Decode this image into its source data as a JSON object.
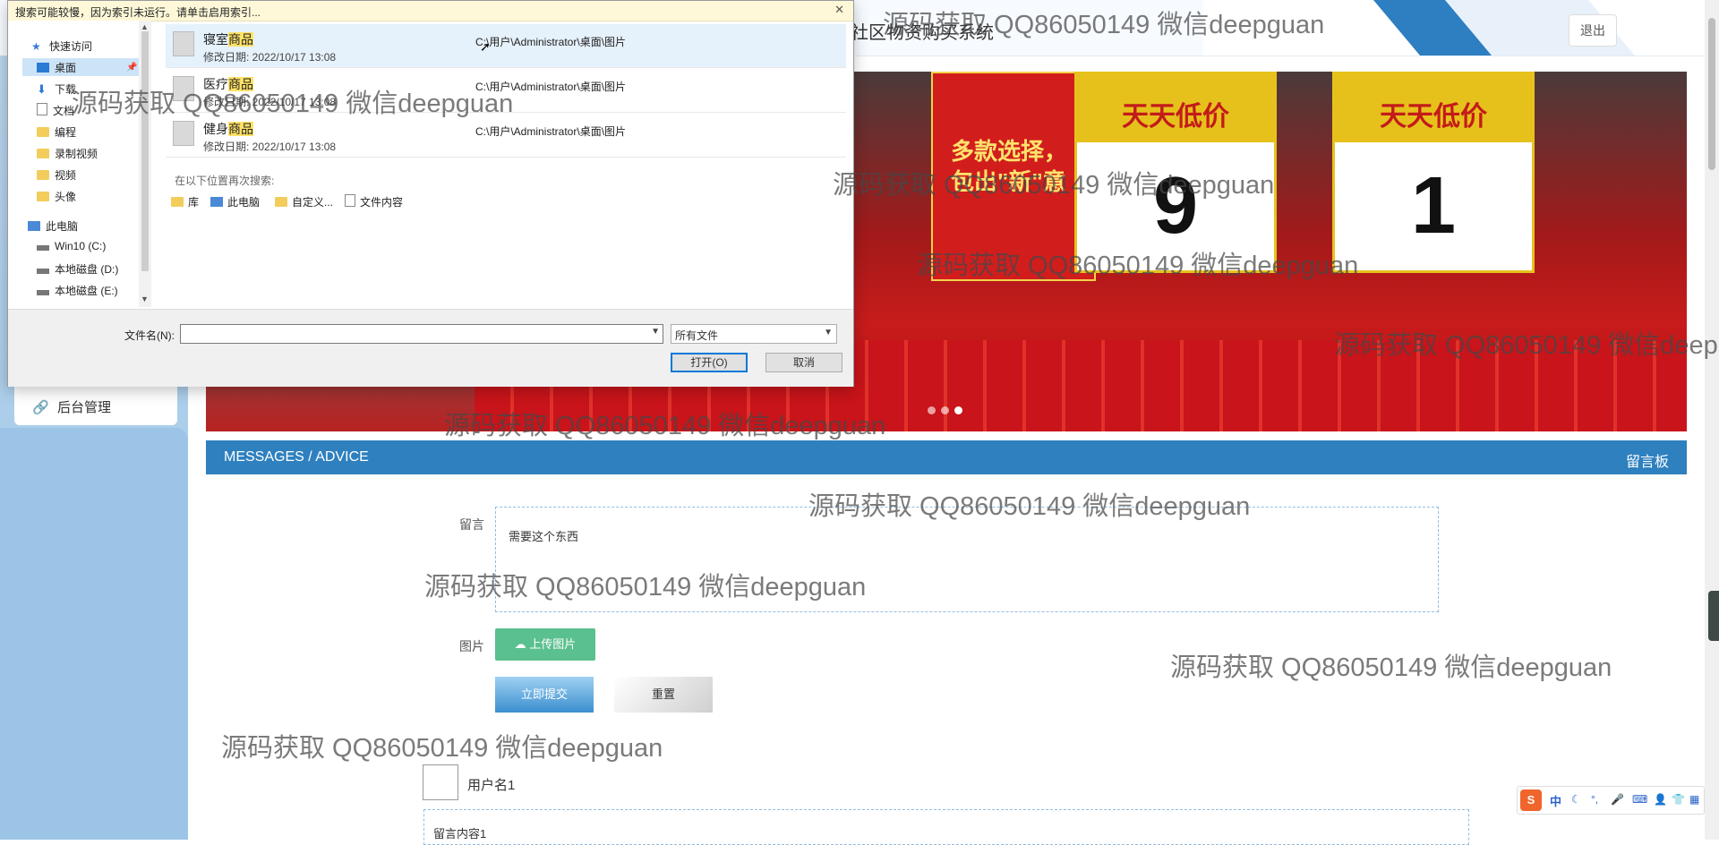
{
  "site": {
    "title": "社区物资购买系统",
    "logout_label": "退出"
  },
  "sidebar": {
    "admin_label": "后台管理",
    "admin_icon": "link-icon"
  },
  "banner": {
    "sign1_top": "天天低价",
    "sign1_price": "9",
    "sign2_top": "天天低价",
    "sign2_price": "1",
    "poster_text": "多款选择，包出\"新\"意",
    "dots_count": 3,
    "active_dot": 3
  },
  "messages": {
    "bar_left": "MESSAGES / ADVICE",
    "bar_right": "留言板",
    "message_label": "留言",
    "message_value": "需要这个东西",
    "image_label": "图片",
    "upload_label": "上传图片",
    "submit_label": "立即提交",
    "reset_label": "重置",
    "comment_user": "用户名1",
    "comment_content": "留言内容1"
  },
  "dialog": {
    "warning": "搜索可能较慢，因为索引未运行。请单击启用索引...",
    "close_icon": "close-icon",
    "nav": {
      "quick_access": "快速访问",
      "items": [
        "桌面",
        "下载",
        "文档",
        "编程",
        "录制视频",
        "视频",
        "头像"
      ],
      "this_pc": "此电脑",
      "drives": [
        "Win10 (C:)",
        "本地磁盘 (D:)",
        "本地磁盘 (E:)"
      ]
    },
    "results": [
      {
        "name_prefix": "寝室",
        "name_hl": "商品",
        "date": "修改日期: 2022/10/17 13:08",
        "path": "C:\\用户\\Administrator\\桌面\\图片"
      },
      {
        "name_prefix": "医疗",
        "name_hl": "商品",
        "date": "修改日期: 2022/10/17 13:08",
        "path": "C:\\用户\\Administrator\\桌面\\图片"
      },
      {
        "name_prefix": "健身",
        "name_hl": "商品",
        "date": "修改日期: 2022/10/17 13:08",
        "path": "C:\\用户\\Administrator\\桌面\\图片"
      }
    ],
    "search_again": "在以下位置再次搜索:",
    "search_locations": [
      "库",
      "此电脑",
      "自定义...",
      "文件内容"
    ],
    "filename_label": "文件名(N):",
    "filename_value": "",
    "filetype_value": "所有文件",
    "open_label": "打开(O)",
    "cancel_label": "取消"
  },
  "watermark": "源码获取 QQ86050149 微信deepguan",
  "ime": {
    "logo": "S",
    "mode": "中"
  },
  "colors": {
    "accent": "#2e80bf",
    "upload": "#5bc08f",
    "sidebar": "#9cc4e6",
    "selection": "#cce4f7",
    "highlight": "#ffe266"
  }
}
